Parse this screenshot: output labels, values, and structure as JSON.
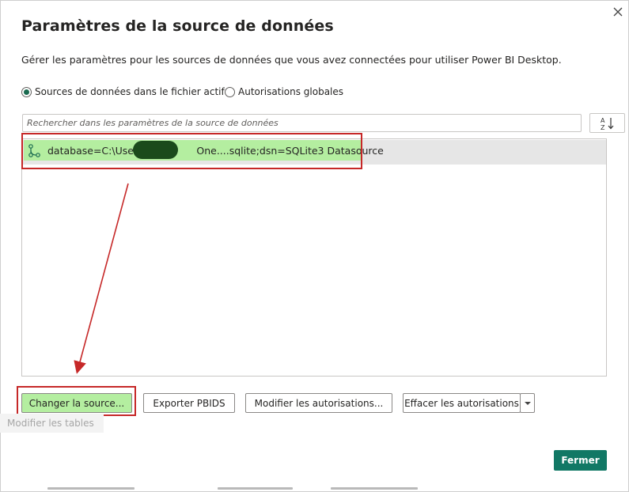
{
  "dialog": {
    "title": "Paramètres de la source de données",
    "description": "Gérer les paramètres pour les sources de données que vous avez connectées pour utiliser Power BI Desktop.",
    "close_icon": "close-icon"
  },
  "scope": {
    "options": [
      {
        "label": "Sources de données dans le fichier actif",
        "selected": true
      },
      {
        "label": "Autorisations globales",
        "selected": false
      }
    ]
  },
  "search": {
    "placeholder": "Rechercher dans les paramètres de la source de données",
    "value": ""
  },
  "sort": {
    "icon": "sort-az-icon"
  },
  "list": {
    "items": [
      {
        "icon": "data-source-connection-icon",
        "label": "database=C:\\Users\\                One....sqlite;dsn=SQLite3 Datasource",
        "selected": true,
        "redacted_segment": true
      }
    ]
  },
  "buttons": {
    "change_source": "Changer la source...",
    "export_pbids": "Exporter PBIDS",
    "edit_permissions": "Modifier les autorisations...",
    "clear_permissions": "Effacer les autorisations",
    "clear_dropdown_icon": "chevron-down-icon",
    "close": "Fermer"
  },
  "background": {
    "edit_tables": "Modifier les tables"
  },
  "colors": {
    "accent": "#117865",
    "highlight": "#b4eea0",
    "annotation": "#c62828"
  }
}
